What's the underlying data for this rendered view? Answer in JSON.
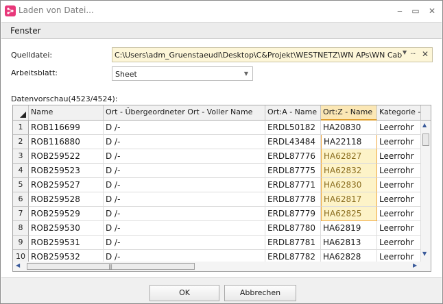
{
  "window": {
    "title": "Laden von Datei...",
    "minimize_label": "‒",
    "maximize_label": "▭",
    "close_label": "✕"
  },
  "menu": {
    "items": [
      "Fenster"
    ]
  },
  "form": {
    "source_label": "Quelldatei:",
    "source_value": "C:\\Users\\adm_Gruenstaeudl\\Desktop\\C&Projekt\\WESTNETZ\\WN APs\\WN Cablesco",
    "sheet_label": "Arbeitsblatt:",
    "sheet_value": "Sheet",
    "preview_label": "Datenvorschau(4523/4524):"
  },
  "grid": {
    "columns": [
      "Name",
      "Ort - Übergeordneter Ort - Voller Name",
      "Ort:A - Name",
      "Ort:Z - Name",
      "Kategorie -"
    ],
    "rows": [
      {
        "num": "1",
        "cells": [
          "ROB116699",
          "D /-",
          "ERDL50182",
          "HA20830",
          "Leerrohr"
        ]
      },
      {
        "num": "2",
        "cells": [
          "ROB116880",
          "D /-",
          "ERDL43484",
          "HA22118",
          "Leerrohr"
        ]
      },
      {
        "num": "3",
        "cells": [
          "ROB259522",
          "D /-",
          "ERDL87776",
          "HA62827",
          "Leerrohr"
        ]
      },
      {
        "num": "4",
        "cells": [
          "ROB259523",
          "D /-",
          "ERDL87775",
          "HA62832",
          "Leerrohr"
        ]
      },
      {
        "num": "5",
        "cells": [
          "ROB259527",
          "D /-",
          "ERDL87771",
          "HA62830",
          "Leerrohr"
        ]
      },
      {
        "num": "6",
        "cells": [
          "ROB259528",
          "D /-",
          "ERDL87778",
          "HA62817",
          "Leerrohr"
        ]
      },
      {
        "num": "7",
        "cells": [
          "ROB259529",
          "D /-",
          "ERDL87779",
          "HA62825",
          "Leerrohr"
        ]
      },
      {
        "num": "8",
        "cells": [
          "ROB259530",
          "D /-",
          "ERDL87780",
          "HA62819",
          "Leerrohr"
        ]
      },
      {
        "num": "9",
        "cells": [
          "ROB259531",
          "D /-",
          "ERDL87781",
          "HA62813",
          "Leerrohr"
        ]
      },
      {
        "num": "10",
        "cells": [
          "ROB259532",
          "D /-",
          "ERDL87782",
          "HA62828",
          "Leerrohr"
        ]
      }
    ],
    "selected_column": "Ort:Z - Name",
    "focused_row": "2",
    "highlighted_rows": [
      "3",
      "4",
      "5",
      "6",
      "7"
    ],
    "highlight_color": "#fdf3c8",
    "selection_border_color": "#f0a840"
  },
  "buttons": {
    "ok": "OK",
    "cancel": "Abbrechen"
  }
}
